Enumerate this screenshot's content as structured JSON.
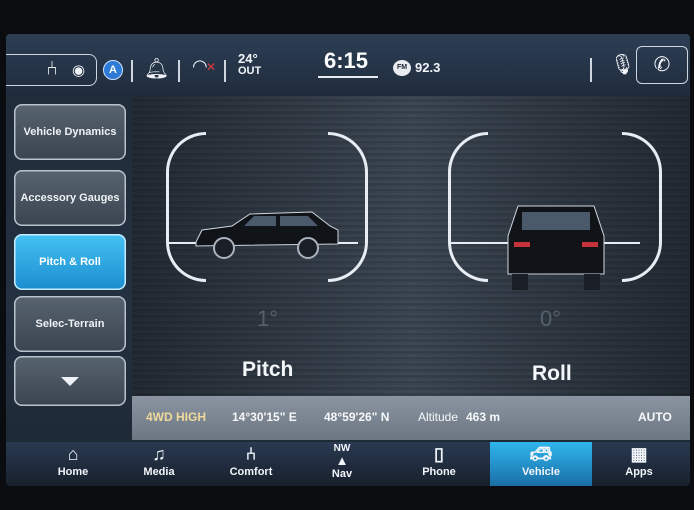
{
  "status_bar": {
    "temperature": "24°",
    "temperature_label": "OUT",
    "time": "6:15",
    "radio_band": "FM",
    "radio_frequency": "92.3"
  },
  "sidebar": {
    "items": [
      {
        "label": "Vehicle Dynamics"
      },
      {
        "label": "Accessory Gauges"
      },
      {
        "label": "Pitch & Roll"
      },
      {
        "label": "Selec-Terrain"
      }
    ]
  },
  "main": {
    "pitch_value": "1°",
    "pitch_label": "Pitch",
    "roll_value": "0°",
    "roll_label": "Roll"
  },
  "info_bar": {
    "drive_mode": "4WD HIGH",
    "longitude": "14°30'15\" E",
    "latitude": "48°59'26\" N",
    "altitude_label": "Altitude",
    "altitude_value": "463 m",
    "auto_label": "AUTO"
  },
  "nav": {
    "items": [
      {
        "label": "Home",
        "icon": "home-icon"
      },
      {
        "label": "Media",
        "icon": "music-note-icon"
      },
      {
        "label": "Comfort",
        "icon": "seat-icon"
      },
      {
        "label": "Nav",
        "icon": "compass-icon",
        "heading": "NW"
      },
      {
        "label": "Phone",
        "icon": "phone-icon"
      },
      {
        "label": "Vehicle",
        "icon": "car-icon"
      },
      {
        "label": "Apps",
        "icon": "grid-icon"
      }
    ],
    "active": "Vehicle"
  },
  "colors": {
    "accent": "#2fb6ee",
    "drive_mode": "#f0d99b",
    "wifi_alert": "#e03a3a"
  }
}
